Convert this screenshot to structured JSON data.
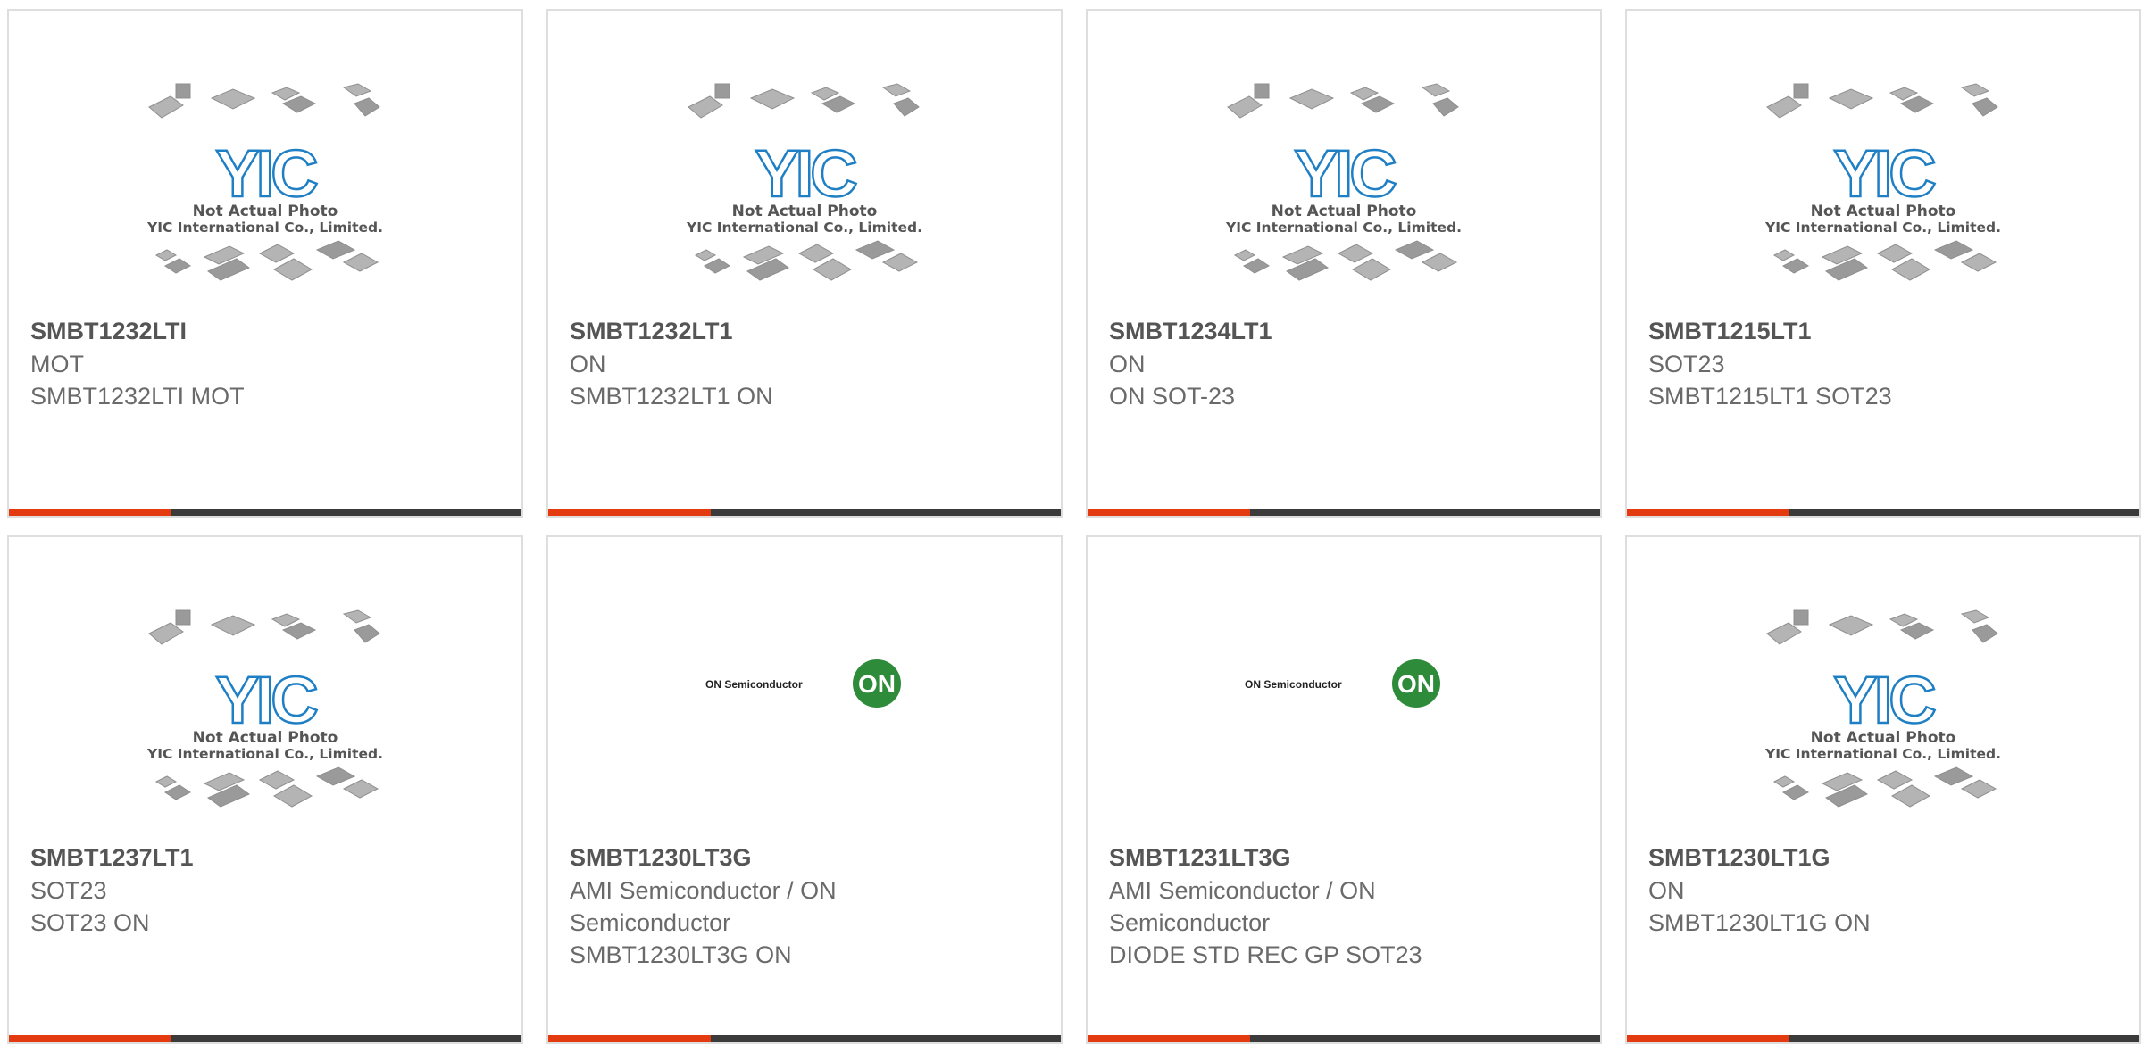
{
  "products": [
    {
      "part": "SMBT1232LTI",
      "lines": [
        "MOT",
        "SMBT1232LTI MOT"
      ],
      "image": "yic-placeholder"
    },
    {
      "part": "SMBT1232LT1",
      "lines": [
        "ON",
        "SMBT1232LT1 ON"
      ],
      "image": "yic-placeholder"
    },
    {
      "part": "SMBT1234LT1",
      "lines": [
        "ON",
        "ON SOT-23"
      ],
      "image": "yic-placeholder"
    },
    {
      "part": "SMBT1215LT1",
      "lines": [
        "SOT23",
        "SMBT1215LT1 SOT23"
      ],
      "image": "yic-placeholder"
    },
    {
      "part": "SMBT1237LT1",
      "lines": [
        "SOT23",
        "SOT23 ON"
      ],
      "image": "yic-placeholder"
    },
    {
      "part": "SMBT1230LT3G",
      "lines": [
        "AMI Semiconductor / ON",
        "Semiconductor",
        "SMBT1230LT3G ON"
      ],
      "image": "on-semi-logo"
    },
    {
      "part": "SMBT1231LT3G",
      "lines": [
        "AMI Semiconductor / ON",
        "Semiconductor",
        "DIODE STD REC GP SOT23"
      ],
      "image": "on-semi-logo"
    },
    {
      "part": "SMBT1230LT1G",
      "lines": [
        "ON",
        "SMBT1230LT1G ON"
      ],
      "image": "yic-placeholder"
    }
  ],
  "placeholder": {
    "logo_text": "YIC",
    "caption_1": "Not Actual Photo",
    "caption_2": "YIC International Co., Limited."
  },
  "on_logo": {
    "wordmark": "ON Semiconductor",
    "mark": "ON"
  },
  "colors": {
    "accent": "#e43a10",
    "bar": "#3b3b3b",
    "yic_blue": "#1f7fc4",
    "on_green": "#2e8b3a"
  }
}
